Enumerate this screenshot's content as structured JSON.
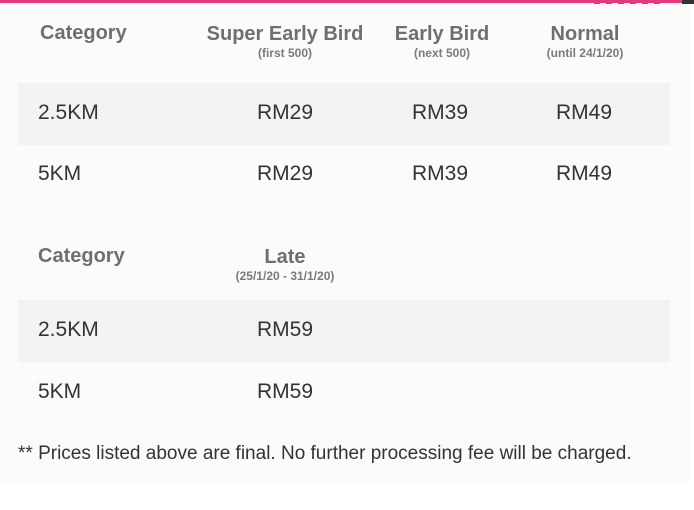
{
  "table1": {
    "header": {
      "category": "Category",
      "col1": {
        "title": "Super Early Bird",
        "sub": "(first 500)"
      },
      "col2": {
        "title": "Early Bird",
        "sub": "(next 500)"
      },
      "col3": {
        "title": "Normal",
        "sub": "(until 24/1/20)"
      }
    },
    "rows": [
      {
        "category": "2.5KM",
        "v1": "RM29",
        "v2": "RM39",
        "v3": "RM49"
      },
      {
        "category": "5KM",
        "v1": "RM29",
        "v2": "RM39",
        "v3": "RM49"
      }
    ]
  },
  "table2": {
    "header": {
      "category": "Category",
      "col1": {
        "title": "Late",
        "sub": "(25/1/20 - 31/1/20)"
      }
    },
    "rows": [
      {
        "category": "2.5KM",
        "v1": "RM59"
      },
      {
        "category": "5KM",
        "v1": "RM59"
      }
    ]
  },
  "note": "** Prices listed above are final. No further processing fee will be charged.",
  "colors": {
    "accent": "#e23a7a",
    "header_text": "#6f6f6f",
    "body_text": "#333333",
    "row_shade": "#f3f3f3"
  }
}
